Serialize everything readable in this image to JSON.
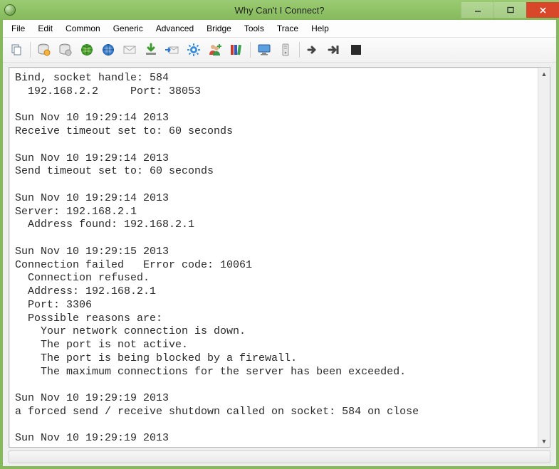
{
  "window": {
    "title": "Why Can't I Connect?"
  },
  "menu": {
    "items": [
      "File",
      "Edit",
      "Common",
      "Generic",
      "Advanced",
      "Bridge",
      "Tools",
      "Trace",
      "Help"
    ]
  },
  "toolbar": {
    "items": [
      "copy-icon",
      "|",
      "db-green-icon",
      "db-grey-icon",
      "globe-green-icon",
      "globe-blue-icon",
      "mail-icon",
      "download-icon",
      "send-mail-icon",
      "gear-icon",
      "user-add-icon",
      "books-icon",
      "|",
      "monitor-icon",
      "server-tower-icon",
      "|",
      "arrow-right-icon",
      "arrow-right-bar-icon",
      "stop-icon"
    ]
  },
  "log": {
    "lines": [
      "Bind, socket handle: 584",
      "  192.168.2.2     Port: 38053",
      "",
      "Sun Nov 10 19:29:14 2013",
      "Receive timeout set to: 60 seconds",
      "",
      "Sun Nov 10 19:29:14 2013",
      "Send timeout set to: 60 seconds",
      "",
      "Sun Nov 10 19:29:14 2013",
      "Server: 192.168.2.1",
      "  Address found: 192.168.2.1",
      "",
      "Sun Nov 10 19:29:15 2013",
      "Connection failed   Error code: 10061",
      "  Connection refused.",
      "  Address: 192.168.2.1",
      "  Port: 3306",
      "  Possible reasons are:",
      "    Your network connection is down.",
      "    The port is not active.",
      "    The port is being blocked by a firewall.",
      "    The maximum connections for the server has been exceeded.",
      "",
      "Sun Nov 10 19:29:19 2013",
      "a forced send / receive shutdown called on socket: 584 on close",
      "",
      "Sun Nov 10 19:29:19 2013"
    ]
  }
}
